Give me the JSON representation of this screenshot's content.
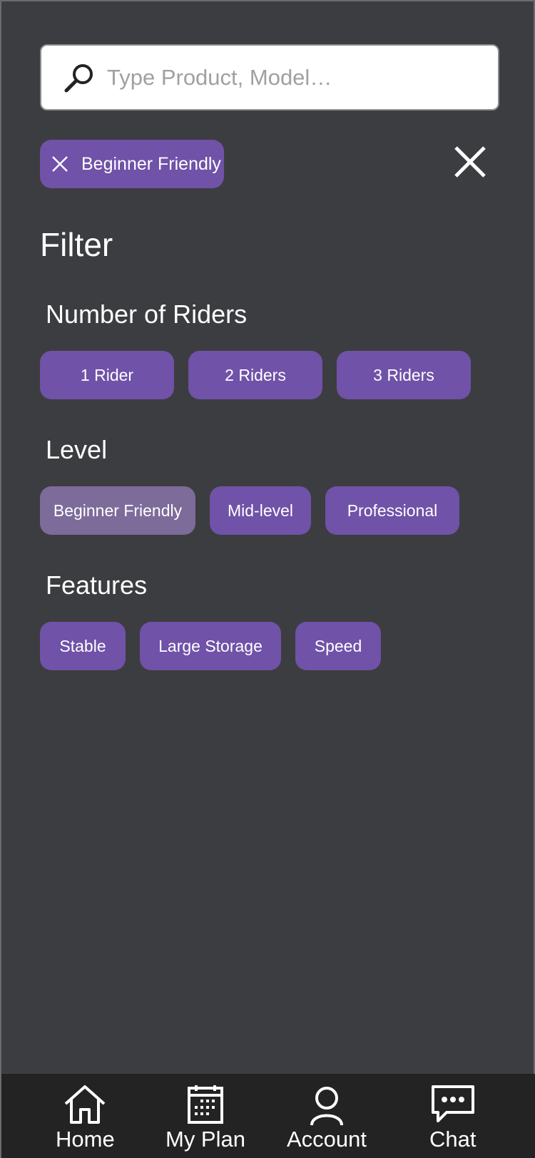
{
  "search": {
    "placeholder": "Type Product, Model…",
    "icon": "search-icon"
  },
  "active_filters": [
    {
      "label": "Beginner Friendly",
      "remove_icon": "close-icon"
    }
  ],
  "close_icon": "close-icon",
  "filter": {
    "title": "Filter",
    "sections": [
      {
        "heading": "Number of Riders",
        "options": [
          {
            "label": "1 Rider",
            "selected": false
          },
          {
            "label": "2 Riders",
            "selected": false
          },
          {
            "label": "3 Riders",
            "selected": false
          }
        ]
      },
      {
        "heading": "Level",
        "options": [
          {
            "label": "Beginner Friendly",
            "selected": true
          },
          {
            "label": "Mid-level",
            "selected": false
          },
          {
            "label": "Professional",
            "selected": false
          }
        ]
      },
      {
        "heading": "Features",
        "options": [
          {
            "label": "Stable",
            "selected": false
          },
          {
            "label": "Large Storage",
            "selected": false
          },
          {
            "label": "Speed",
            "selected": false
          }
        ]
      }
    ]
  },
  "nav": {
    "items": [
      {
        "label": "Home",
        "icon": "home-icon"
      },
      {
        "label": "My Plan",
        "icon": "calendar-icon"
      },
      {
        "label": "Account",
        "icon": "user-icon"
      },
      {
        "label": "Chat",
        "icon": "chat-icon"
      }
    ]
  },
  "colors": {
    "background": "#3c3d40",
    "chip": "#7052a8",
    "chip_selected": "#7d6b9a",
    "nav_background": "#232323"
  }
}
